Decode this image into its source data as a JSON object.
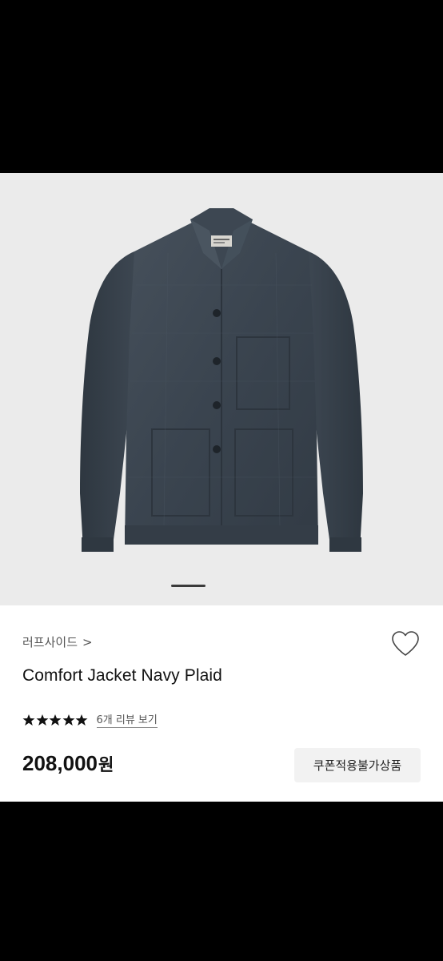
{
  "product": {
    "brand": "러프사이드",
    "brand_chevron": ">",
    "name": "Comfort Jacket Navy Plaid",
    "rating": 5,
    "rating_max": 5,
    "review_link": "6개 리뷰 보기",
    "price_amount": "208,000",
    "price_unit": "원",
    "coupon_notice": "쿠폰적용불가상품"
  },
  "gallery": {
    "image_subject": "navy plaid work jacket",
    "current_page": 1
  },
  "colors": {
    "jacket": "#3c4651",
    "image_background": "#ebebeb",
    "panel_background": "#ffffff",
    "badge_background": "#f2f2f2",
    "text_primary": "#111111"
  },
  "icons": {
    "wishlist": "heart-icon",
    "rating": "star-icon"
  }
}
